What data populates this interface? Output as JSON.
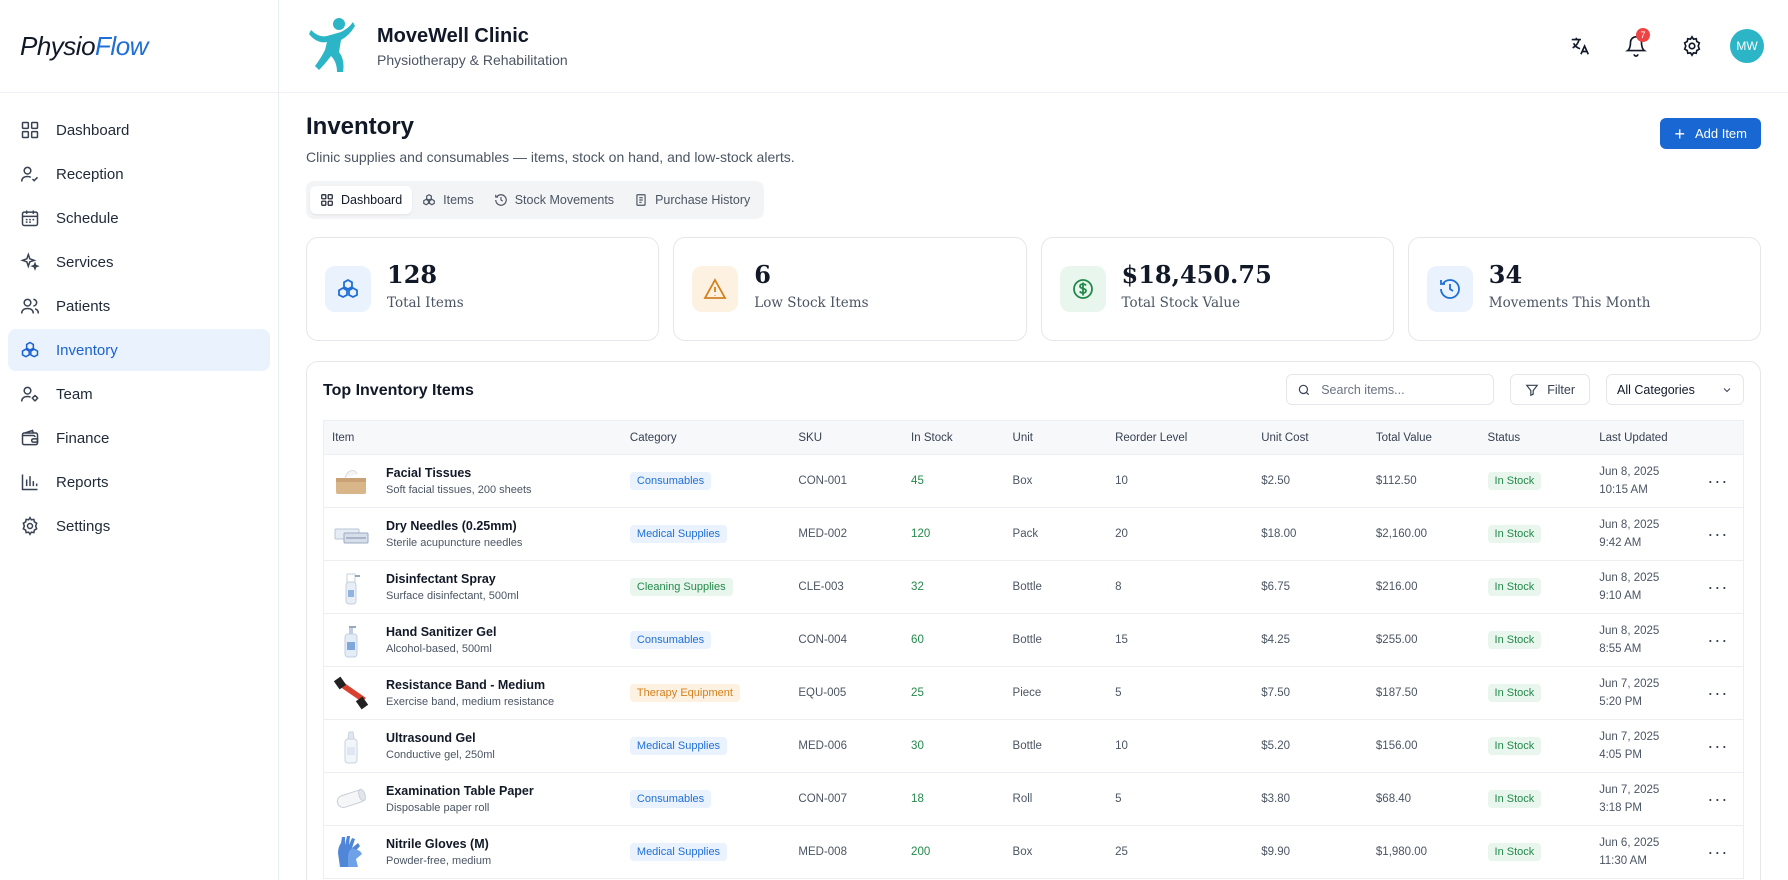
{
  "brand": {
    "part1": "Physio",
    "part2": "Flow"
  },
  "sidebar": {
    "items": [
      {
        "label": "Dashboard",
        "icon": "grid-icon"
      },
      {
        "label": "Reception",
        "icon": "user-check-icon"
      },
      {
        "label": "Schedule",
        "icon": "calendar-icon"
      },
      {
        "label": "Services",
        "icon": "sparkles-icon"
      },
      {
        "label": "Patients",
        "icon": "users-icon"
      },
      {
        "label": "Inventory",
        "icon": "boxes-icon"
      },
      {
        "label": "Team",
        "icon": "user-cog-icon"
      },
      {
        "label": "Finance",
        "icon": "wallet-icon"
      },
      {
        "label": "Reports",
        "icon": "bar-chart-icon"
      },
      {
        "label": "Settings",
        "icon": "gear-icon"
      }
    ],
    "active": "Inventory"
  },
  "header": {
    "clinic_name": "MoveWell Clinic",
    "clinic_sub": "Physiotherapy & Rehabilitation",
    "notifications_count": "7",
    "avatar_initials": "MW"
  },
  "page": {
    "title": "Inventory",
    "subtitle": "Clinic supplies and consumables — items, stock on hand, and low-stock alerts.",
    "add_button": "Add Item"
  },
  "tabs": [
    {
      "label": "Dashboard",
      "active": true
    },
    {
      "label": "Items"
    },
    {
      "label": "Stock Movements"
    },
    {
      "label": "Purchase History"
    }
  ],
  "stats": [
    {
      "value": "128",
      "label": "Total Items",
      "color": "#1f6fd6",
      "bg": "#eaf2fd"
    },
    {
      "value": "6",
      "label": "Low Stock Items",
      "color": "#d3811d",
      "bg": "#fdf1e2"
    },
    {
      "value": "$18,450.75",
      "label": "Total Stock Value",
      "color": "#23894a",
      "bg": "#e8f6ed"
    },
    {
      "value": "34",
      "label": "Movements This Month",
      "color": "#1f6fd6",
      "bg": "#eaf2fd"
    }
  ],
  "table": {
    "title": "Top Inventory Items",
    "search_placeholder": "Search items...",
    "filter_label": "Filter",
    "category_select": "All Categories",
    "columns": [
      "Item",
      "Category",
      "SKU",
      "In Stock",
      "Unit",
      "Reorder Level",
      "Unit Cost",
      "Total Value",
      "Status",
      "Last Updated"
    ],
    "rows": [
      {
        "name": "Facial Tissues",
        "desc": "Soft facial tissues, 200 sheets",
        "category": "Consumables",
        "cat_color": "blue",
        "sku": "CON-001",
        "stock": "45",
        "unit": "Box",
        "reorder": "10",
        "cost": "$2.50",
        "total": "$112.50",
        "status": "In Stock",
        "date": "Jun 8, 2025",
        "time": "10:15 AM",
        "thumb": "tissue-box"
      },
      {
        "name": "Dry Needles (0.25mm)",
        "desc": "Sterile acupuncture needles",
        "category": "Medical Supplies",
        "cat_color": "blue",
        "sku": "MED-002",
        "stock": "120",
        "unit": "Pack",
        "reorder": "20",
        "cost": "$18.00",
        "total": "$2,160.00",
        "status": "In Stock",
        "date": "Jun 8, 2025",
        "time": "9:42 AM",
        "thumb": "needle-pack"
      },
      {
        "name": "Disinfectant Spray",
        "desc": "Surface disinfectant, 500ml",
        "category": "Cleaning Supplies",
        "cat_color": "green",
        "sku": "CLE-003",
        "stock": "32",
        "unit": "Bottle",
        "reorder": "8",
        "cost": "$6.75",
        "total": "$216.00",
        "status": "In Stock",
        "date": "Jun 8, 2025",
        "time": "9:10 AM",
        "thumb": "spray-bottle"
      },
      {
        "name": "Hand Sanitizer Gel",
        "desc": "Alcohol-based, 500ml",
        "category": "Consumables",
        "cat_color": "blue",
        "sku": "CON-004",
        "stock": "60",
        "unit": "Bottle",
        "reorder": "15",
        "cost": "$4.25",
        "total": "$255.00",
        "status": "In Stock",
        "date": "Jun 8, 2025",
        "time": "8:55 AM",
        "thumb": "pump-bottle"
      },
      {
        "name": "Resistance Band - Medium",
        "desc": "Exercise band, medium resistance",
        "category": "Therapy Equipment",
        "cat_color": "orange",
        "sku": "EQU-005",
        "stock": "25",
        "unit": "Piece",
        "reorder": "5",
        "cost": "$7.50",
        "total": "$187.50",
        "status": "In Stock",
        "date": "Jun 7, 2025",
        "time": "5:20 PM",
        "thumb": "resistance-band"
      },
      {
        "name": "Ultrasound Gel",
        "desc": "Conductive gel, 250ml",
        "category": "Medical Supplies",
        "cat_color": "blue",
        "sku": "MED-006",
        "stock": "30",
        "unit": "Bottle",
        "reorder": "10",
        "cost": "$5.20",
        "total": "$156.00",
        "status": "In Stock",
        "date": "Jun 7, 2025",
        "time": "4:05 PM",
        "thumb": "gel-bottle"
      },
      {
        "name": "Examination Table Paper",
        "desc": "Disposable paper roll",
        "category": "Consumables",
        "cat_color": "blue",
        "sku": "CON-007",
        "stock": "18",
        "unit": "Roll",
        "reorder": "5",
        "cost": "$3.80",
        "total": "$68.40",
        "status": "In Stock",
        "date": "Jun 7, 2025",
        "time": "3:18 PM",
        "thumb": "paper-roll"
      },
      {
        "name": "Nitrile Gloves (M)",
        "desc": "Powder-free, medium",
        "category": "Medical Supplies",
        "cat_color": "blue",
        "sku": "MED-008",
        "stock": "200",
        "unit": "Box",
        "reorder": "25",
        "cost": "$9.90",
        "total": "$1,980.00",
        "status": "In Stock",
        "date": "Jun 6, 2025",
        "time": "11:30 AM",
        "thumb": "gloves"
      }
    ]
  }
}
